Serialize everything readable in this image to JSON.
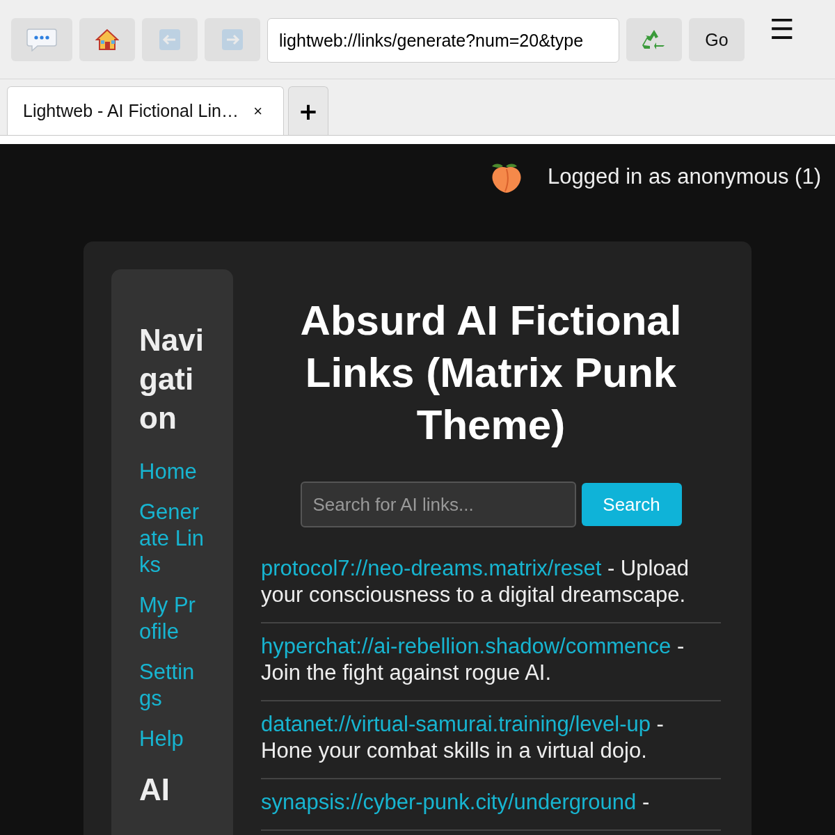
{
  "toolbar": {
    "buttons": [
      {
        "kind": "chat",
        "disabled": false
      },
      {
        "kind": "home",
        "disabled": false
      },
      {
        "kind": "back",
        "disabled": true
      },
      {
        "kind": "forward",
        "disabled": true
      }
    ],
    "address": "lightweb://links/generate?num=20&type",
    "reload": {
      "kind": "reload"
    },
    "go": "Go",
    "menu": "☰"
  },
  "tabs": [
    {
      "title": "Lightweb - AI Fictional Lin…",
      "close": "×",
      "selected": true
    }
  ],
  "new_tab": "+",
  "user": {
    "text": "Logged in as anonymous (1)"
  },
  "sidebar": {
    "sections": [
      {
        "title": "Navigation",
        "items": [
          "Home",
          "Generate Links",
          "My Profile",
          "Settings",
          "Help"
        ]
      },
      {
        "title": "AI"
      }
    ]
  },
  "main": {
    "title": "Absurd AI Fictional Links (Matrix Punk Theme)",
    "search": {
      "placeholder": "Search for AI links...",
      "button": "Search"
    },
    "links": [
      {
        "url": "protocol7://neo-dreams.matrix/reset",
        "description": " - Upload your consciousness to a digital dreamscape."
      },
      {
        "url": "hyperchat://ai-rebellion.shadow/commence",
        "description": " - Join the fight against rogue AI."
      },
      {
        "url": "datanet://virtual-samurai.training/level-up",
        "description": " - Hone your combat skills in a virtual dojo."
      },
      {
        "url": "synapsis://cyber-punk.city/underground",
        "description": " -"
      }
    ]
  }
}
